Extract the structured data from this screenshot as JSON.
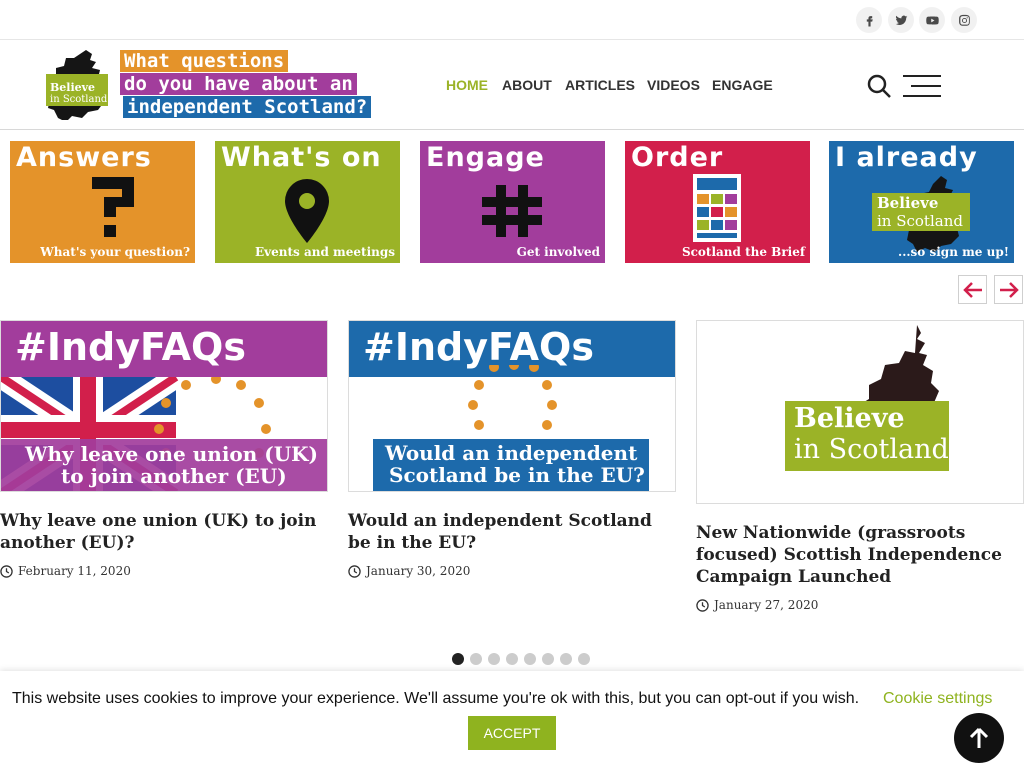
{
  "colors": {
    "brand_green": "#9bb327",
    "accent_orange": "#e4932a",
    "accent_purple": "#a23d9c",
    "accent_red": "#d21f4b",
    "accent_blue": "#1d6aab",
    "dark": "#222222"
  },
  "social": [
    {
      "icon": "facebook-icon"
    },
    {
      "icon": "twitter-icon"
    },
    {
      "icon": "youtube-icon"
    },
    {
      "icon": "instagram-icon"
    }
  ],
  "logo": {
    "mark_line1": "Believe",
    "mark_line2": "in Scotland",
    "tagline_line1": "What questions",
    "tagline_line2": "do you have about an",
    "tagline_line3": "independent Scotland?"
  },
  "nav": {
    "items": [
      {
        "label": "HOME",
        "active": true
      },
      {
        "label": "ABOUT",
        "active": false
      },
      {
        "label": "ARTICLES",
        "active": false
      },
      {
        "label": "VIDEOS",
        "active": false
      },
      {
        "label": "ENGAGE",
        "active": false
      }
    ],
    "search_icon": "search-icon",
    "menu_icon": "hamburger-menu-icon"
  },
  "tiles": [
    {
      "title": "Answers",
      "sub": "What's your question?",
      "icon": "question-mark-icon"
    },
    {
      "title": "What's on",
      "sub": "Events and meetings",
      "icon": "map-pin-icon"
    },
    {
      "title": "Engage",
      "sub": "Get involved",
      "icon": "hashtag-icon"
    },
    {
      "title": "Order",
      "sub": "Scotland the Brief",
      "icon": "booklet-icon"
    },
    {
      "title": "I already",
      "sub": "...so sign me up!",
      "badge_line1": "Believe",
      "badge_line2": "in Scotland",
      "icon": "scotland-map-icon"
    }
  ],
  "carousel_arrows": {
    "prev_icon": "arrow-left-icon",
    "next_icon": "arrow-right-icon"
  },
  "articles": [
    {
      "img_heading": "#IndyFAQs",
      "img_caption_line1": "Why leave one union (UK)",
      "img_caption_line2": "to join another (EU)",
      "title": "Why leave one union (UK) to join another (EU)?",
      "date": "February 11, 2020"
    },
    {
      "img_heading": "#IndyFAQs",
      "img_caption_line1": "Would an independent",
      "img_caption_line2": "Scotland be in the EU?",
      "title": "Would an independent Scotland be in the EU?",
      "date": "January 30, 2020"
    },
    {
      "img_badge_line1": "Believe",
      "img_badge_line2": "in Scotland",
      "title": "New Nationwide (grassroots focused) Scottish Independence Campaign Launched",
      "date": "January 27, 2020"
    }
  ],
  "pagination": {
    "count": 8,
    "active_index": 0
  },
  "cookie": {
    "text": "This website uses cookies to improve your experience. We'll assume you're ok with this, but you can opt-out if you wish.",
    "settings_label": "Cookie settings",
    "accept_label": "ACCEPT",
    "back_to_top_icon": "arrow-up-icon"
  }
}
